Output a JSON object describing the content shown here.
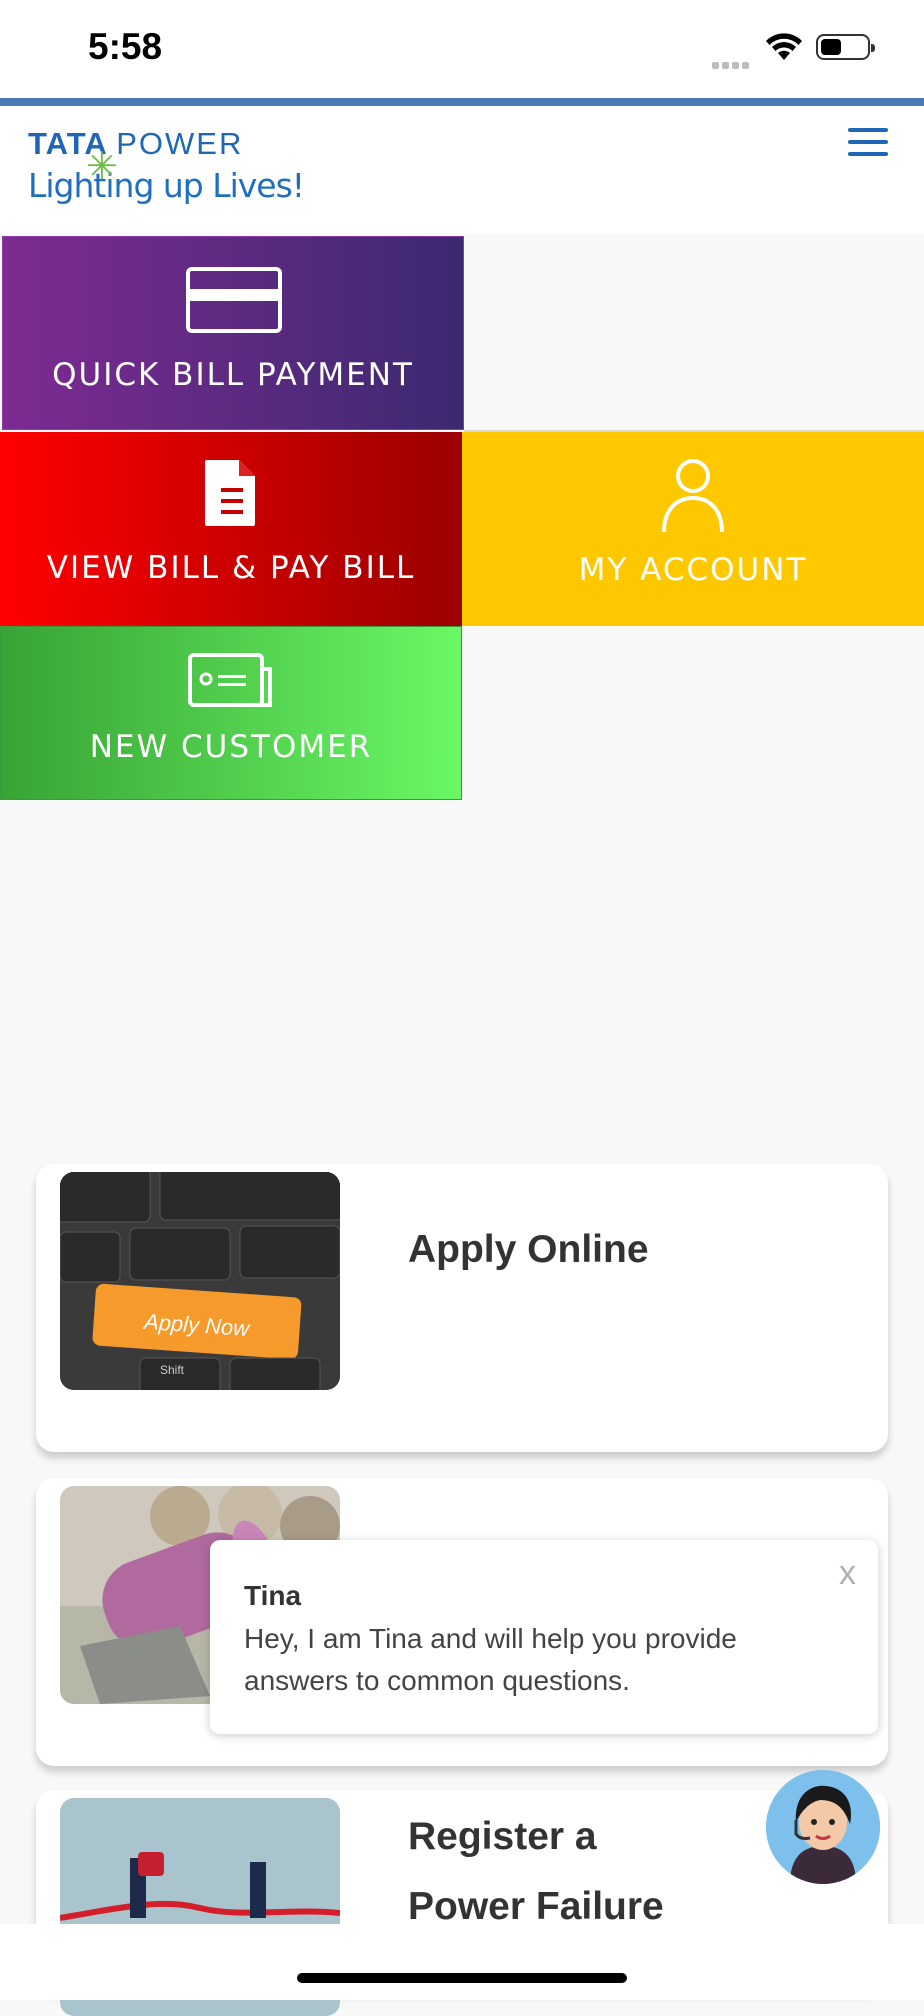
{
  "status_bar": {
    "time": "5:58"
  },
  "header": {
    "brand_tata": "TATA",
    "brand_power": "POWER",
    "tagline": "Lighting up Lives!"
  },
  "tiles": {
    "quick_bill": "QUICK BILL PAYMENT",
    "view_bill": "VIEW BILL & PAY BILL",
    "my_account": "MY ACCOUNT",
    "new_customer": "NEW CUSTOMER"
  },
  "cards": {
    "apply_online": {
      "title": "Apply Online",
      "image_text": "Apply Now",
      "key_shift": "Shift"
    },
    "register_failure": {
      "title_line1": "Register a",
      "title_line2": "Power Failure"
    }
  },
  "chat": {
    "name": "Tina",
    "message": "Hey, I am Tina and will help you provide answers to common questions.",
    "close": "x"
  },
  "colors": {
    "brand_blue": "#1f67b4",
    "quick_bill_start": "#7e2b92",
    "quick_bill_end": "#3c2970",
    "view_bill_start": "#ff0000",
    "view_bill_end": "#9a0000",
    "my_account": "#fec800",
    "new_customer_start": "#38a335",
    "new_customer_end": "#6af865"
  }
}
